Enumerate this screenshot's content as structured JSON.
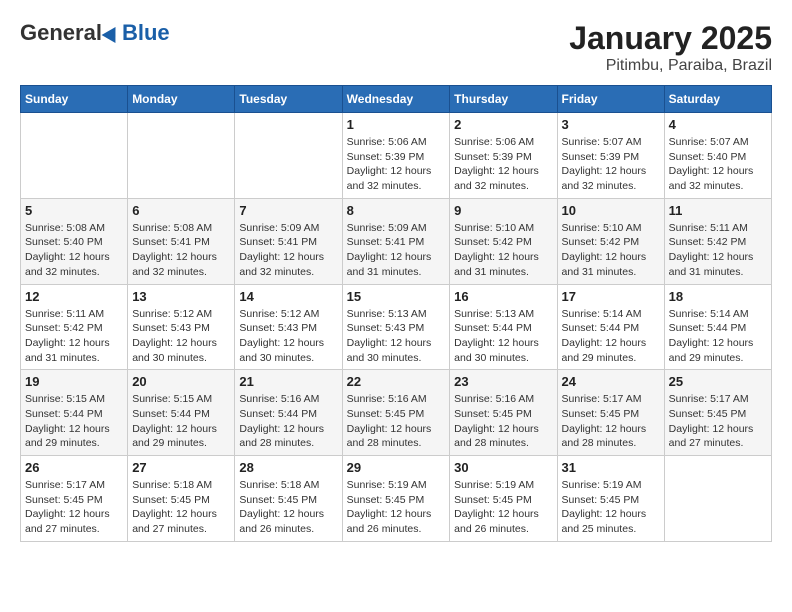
{
  "header": {
    "logo_general": "General",
    "logo_blue": "Blue",
    "title": "January 2025",
    "subtitle": "Pitimbu, Paraiba, Brazil"
  },
  "weekdays": [
    "Sunday",
    "Monday",
    "Tuesday",
    "Wednesday",
    "Thursday",
    "Friday",
    "Saturday"
  ],
  "weeks": [
    [
      {
        "day": "",
        "info": ""
      },
      {
        "day": "",
        "info": ""
      },
      {
        "day": "",
        "info": ""
      },
      {
        "day": "1",
        "info": "Sunrise: 5:06 AM\nSunset: 5:39 PM\nDaylight: 12 hours\nand 32 minutes."
      },
      {
        "day": "2",
        "info": "Sunrise: 5:06 AM\nSunset: 5:39 PM\nDaylight: 12 hours\nand 32 minutes."
      },
      {
        "day": "3",
        "info": "Sunrise: 5:07 AM\nSunset: 5:39 PM\nDaylight: 12 hours\nand 32 minutes."
      },
      {
        "day": "4",
        "info": "Sunrise: 5:07 AM\nSunset: 5:40 PM\nDaylight: 12 hours\nand 32 minutes."
      }
    ],
    [
      {
        "day": "5",
        "info": "Sunrise: 5:08 AM\nSunset: 5:40 PM\nDaylight: 12 hours\nand 32 minutes."
      },
      {
        "day": "6",
        "info": "Sunrise: 5:08 AM\nSunset: 5:41 PM\nDaylight: 12 hours\nand 32 minutes."
      },
      {
        "day": "7",
        "info": "Sunrise: 5:09 AM\nSunset: 5:41 PM\nDaylight: 12 hours\nand 32 minutes."
      },
      {
        "day": "8",
        "info": "Sunrise: 5:09 AM\nSunset: 5:41 PM\nDaylight: 12 hours\nand 31 minutes."
      },
      {
        "day": "9",
        "info": "Sunrise: 5:10 AM\nSunset: 5:42 PM\nDaylight: 12 hours\nand 31 minutes."
      },
      {
        "day": "10",
        "info": "Sunrise: 5:10 AM\nSunset: 5:42 PM\nDaylight: 12 hours\nand 31 minutes."
      },
      {
        "day": "11",
        "info": "Sunrise: 5:11 AM\nSunset: 5:42 PM\nDaylight: 12 hours\nand 31 minutes."
      }
    ],
    [
      {
        "day": "12",
        "info": "Sunrise: 5:11 AM\nSunset: 5:42 PM\nDaylight: 12 hours\nand 31 minutes."
      },
      {
        "day": "13",
        "info": "Sunrise: 5:12 AM\nSunset: 5:43 PM\nDaylight: 12 hours\nand 30 minutes."
      },
      {
        "day": "14",
        "info": "Sunrise: 5:12 AM\nSunset: 5:43 PM\nDaylight: 12 hours\nand 30 minutes."
      },
      {
        "day": "15",
        "info": "Sunrise: 5:13 AM\nSunset: 5:43 PM\nDaylight: 12 hours\nand 30 minutes."
      },
      {
        "day": "16",
        "info": "Sunrise: 5:13 AM\nSunset: 5:44 PM\nDaylight: 12 hours\nand 30 minutes."
      },
      {
        "day": "17",
        "info": "Sunrise: 5:14 AM\nSunset: 5:44 PM\nDaylight: 12 hours\nand 29 minutes."
      },
      {
        "day": "18",
        "info": "Sunrise: 5:14 AM\nSunset: 5:44 PM\nDaylight: 12 hours\nand 29 minutes."
      }
    ],
    [
      {
        "day": "19",
        "info": "Sunrise: 5:15 AM\nSunset: 5:44 PM\nDaylight: 12 hours\nand 29 minutes."
      },
      {
        "day": "20",
        "info": "Sunrise: 5:15 AM\nSunset: 5:44 PM\nDaylight: 12 hours\nand 29 minutes."
      },
      {
        "day": "21",
        "info": "Sunrise: 5:16 AM\nSunset: 5:44 PM\nDaylight: 12 hours\nand 28 minutes."
      },
      {
        "day": "22",
        "info": "Sunrise: 5:16 AM\nSunset: 5:45 PM\nDaylight: 12 hours\nand 28 minutes."
      },
      {
        "day": "23",
        "info": "Sunrise: 5:16 AM\nSunset: 5:45 PM\nDaylight: 12 hours\nand 28 minutes."
      },
      {
        "day": "24",
        "info": "Sunrise: 5:17 AM\nSunset: 5:45 PM\nDaylight: 12 hours\nand 28 minutes."
      },
      {
        "day": "25",
        "info": "Sunrise: 5:17 AM\nSunset: 5:45 PM\nDaylight: 12 hours\nand 27 minutes."
      }
    ],
    [
      {
        "day": "26",
        "info": "Sunrise: 5:17 AM\nSunset: 5:45 PM\nDaylight: 12 hours\nand 27 minutes."
      },
      {
        "day": "27",
        "info": "Sunrise: 5:18 AM\nSunset: 5:45 PM\nDaylight: 12 hours\nand 27 minutes."
      },
      {
        "day": "28",
        "info": "Sunrise: 5:18 AM\nSunset: 5:45 PM\nDaylight: 12 hours\nand 26 minutes."
      },
      {
        "day": "29",
        "info": "Sunrise: 5:19 AM\nSunset: 5:45 PM\nDaylight: 12 hours\nand 26 minutes."
      },
      {
        "day": "30",
        "info": "Sunrise: 5:19 AM\nSunset: 5:45 PM\nDaylight: 12 hours\nand 26 minutes."
      },
      {
        "day": "31",
        "info": "Sunrise: 5:19 AM\nSunset: 5:45 PM\nDaylight: 12 hours\nand 25 minutes."
      },
      {
        "day": "",
        "info": ""
      }
    ]
  ]
}
